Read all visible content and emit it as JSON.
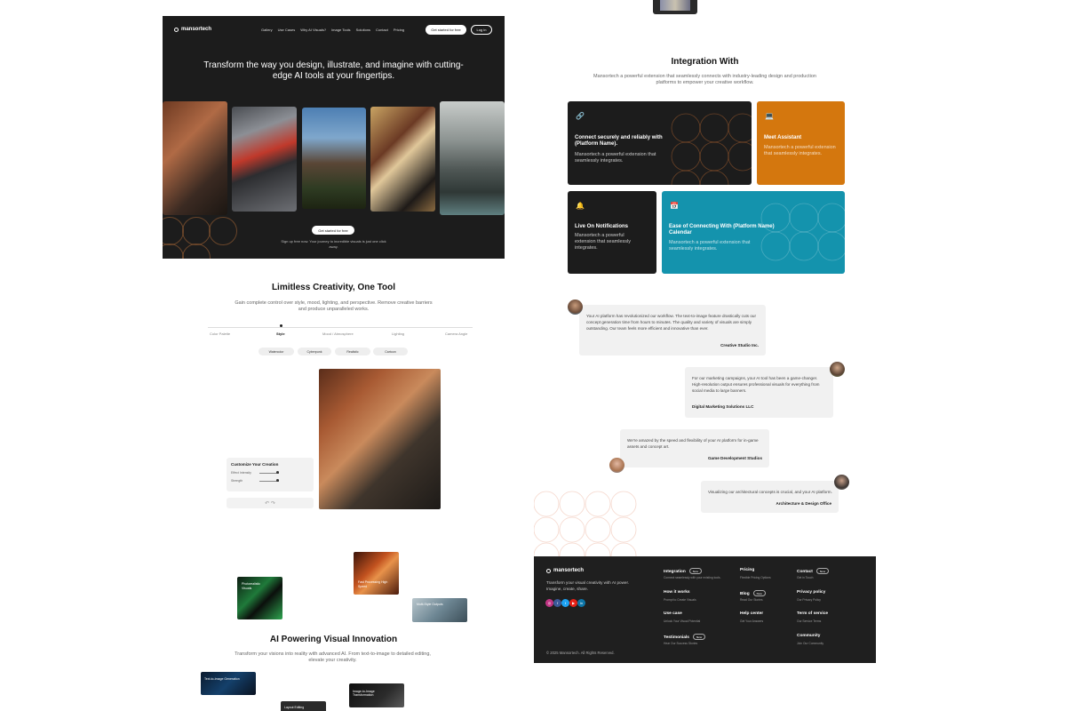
{
  "hero": {
    "logo": "mansortech",
    "nav": [
      "Gallery",
      "Use Cases",
      "Why AI Visuals?",
      "Image Tools",
      "Solutions",
      "Contact",
      "Pricing"
    ],
    "cta_primary": "Get started for free",
    "login": "Log in",
    "title": "Transform the way you design, illustrate, and imagine with cutting-edge AI tools at your fingertips.",
    "cta_center": "Get started for free",
    "subtitle": "Sign up free now. Your journey to incredible visuals is just one click away."
  },
  "creativity": {
    "title": "Limitless Creativity, One Tool",
    "subtitle": "Gain complete control over style, mood, lighting, and perspective. Remove creative barriers and produce unparalleled works.",
    "tabs": [
      "Color Palette",
      "Style",
      "Mood / Atmosphere",
      "Lighting",
      "Camera Angle"
    ],
    "active_tab": "Style",
    "chips": [
      "Watercolor",
      "Cyberpunk",
      "Realistic",
      "Cartoon"
    ],
    "panel_title": "Customize Your Creation",
    "panel_rows": [
      "Effect Intensity",
      "Strength"
    ],
    "undo_redo": "↶ ↷"
  },
  "floating": {
    "thumb1": "Photorealistic Visuals",
    "thumb2": "Fast Processing High Speed",
    "thumb3": "Multi-Style Outputs"
  },
  "ai_powering": {
    "title": "AI Powering Visual Innovation",
    "subtitle": "Transform your visions into reality with advanced AI. From text-to-image to detailed editing, elevate your creativity.",
    "feature1": "Text-to-Image Generation",
    "feature2": "Image-to-Image Transformation",
    "feature3": "Layout Editing"
  },
  "integration": {
    "title": "Integration With",
    "subtitle": "Mansortech a powerful extension that seamlessly connects with industry-leading design and production platforms to empower your creative workflow.",
    "cards": [
      {
        "title": "Connect securely and reliably with (Platform Name).",
        "desc": "Mansortech a powerful extension that seamlessly integrates."
      },
      {
        "title": "Meet Assistant",
        "desc": "Mansortech a powerful extension that seamlessly integrates."
      },
      {
        "title": "Live On Notifications",
        "desc": "Mansortech a powerful extension that seamlessly integrates."
      },
      {
        "title": "Ease of Connecting With (Platform Name) Calendar",
        "desc": "Mansortech a powerful extension that seamlessly integrates."
      }
    ],
    "colors": {
      "dark": "#1c1c1c",
      "orange": "#d4770e",
      "teal": "#1493ad"
    }
  },
  "testimonials": [
    {
      "quote": "Your AI platform has revolutionized our workflow. The text-to-image feature drastically cuts our concept generation time from hours to minutes. The quality and variety of visuals are simply outstanding. Our team feels more efficient and innovative than ever.",
      "author": "Creative Studio Inc."
    },
    {
      "quote": "For our marketing campaigns, your AI tool has been a game-changer. High-resolution output ensures professional visuals for everything from social media to large banners.",
      "author": "Digital Marketing Solutions LLC"
    },
    {
      "quote": "We're amazed by the speed and flexibility of your AI platform for in-game assets and concept art.",
      "author": "Game Development Studios"
    },
    {
      "quote": "Visualizing our architectural concepts is crucial, and your AI platform.",
      "author": "Architecture & Design Office"
    }
  ],
  "footer": {
    "logo": "mansortech",
    "tagline": "Transform your visual creativity with AI power. Imagine, create, share.",
    "copyright": "© 2025 Mansortech. All Rights Reserved.",
    "new_badge": "New",
    "columns": [
      {
        "title": "Integration",
        "desc": "Connect seamlessly with your existing tools."
      },
      {
        "title": "How it works",
        "desc": "Prompt to Create Visuals"
      },
      {
        "title": "Use case",
        "desc": "Unlock Your Visual Potential"
      },
      {
        "title": "Testimonials",
        "desc": "Hear Our Success Stories"
      },
      {
        "title": "Pricing",
        "desc": "Flexible Pricing Options"
      },
      {
        "title": "Blog",
        "desc": "Read Our Stories"
      },
      {
        "title": "Help center",
        "desc": "Get Your Answers"
      },
      {
        "title": "Community",
        "desc": "Join Our Community"
      },
      {
        "title": "Contact",
        "desc": "Get in Touch"
      },
      {
        "title": "Privacy policy",
        "desc": "Our Privacy Policy"
      },
      {
        "title": "Term of service",
        "desc": "Our Service Terms"
      }
    ]
  }
}
